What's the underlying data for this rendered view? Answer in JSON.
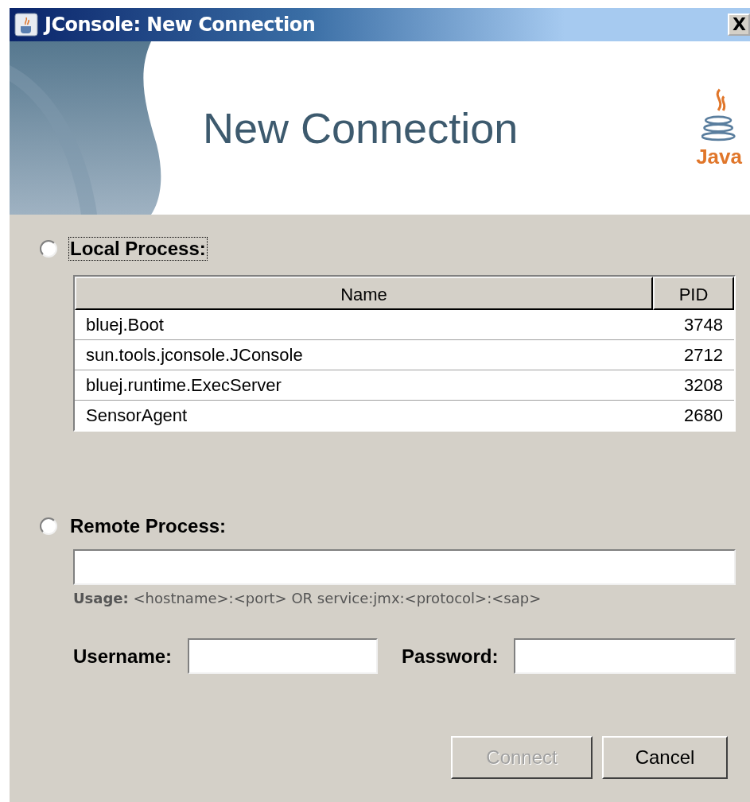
{
  "window": {
    "title": "JConsole: New Connection",
    "close_label": "X"
  },
  "banner": {
    "heading": "New Connection",
    "logo_text": "Java"
  },
  "local": {
    "label": "Local Process:",
    "selected": false,
    "focused": true,
    "table": {
      "columns": [
        "Name",
        "PID"
      ],
      "rows": [
        [
          "bluej.Boot",
          "3748"
        ],
        [
          "sun.tools.jconsole.JConsole",
          "2712"
        ],
        [
          "bluej.runtime.ExecServer",
          "3208"
        ],
        [
          "SensorAgent",
          "2680"
        ]
      ]
    }
  },
  "remote": {
    "label": "Remote Process:",
    "selected": false,
    "usage": "**Usage:** <hostname>:<port> OR service:jmx:<protocol>:<sap>"
  },
  "credentials": {
    "username_label": "Username:",
    "password_label": "Password:"
  },
  "buttons": [
    {
      "label": "Connect",
      "disabled": true
    },
    {
      "label": "Cancel",
      "disabled": false
    }
  ]
}
